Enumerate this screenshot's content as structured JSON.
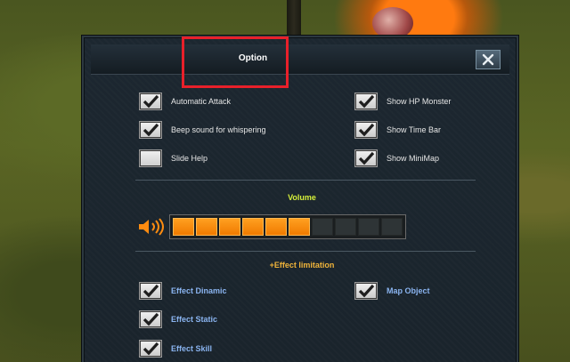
{
  "window": {
    "title": "Option",
    "close_glyph": "✕"
  },
  "options": {
    "automatic_attack": {
      "label": "Automatic Attack",
      "checked": true
    },
    "beep_whisper": {
      "label": "Beep sound for whispering",
      "checked": true
    },
    "slide_help": {
      "label": "Slide Help",
      "checked": false
    },
    "show_hp_monster": {
      "label": "Show HP Monster",
      "checked": true
    },
    "show_time_bar": {
      "label": "Show Time Bar",
      "checked": true
    },
    "show_minimap": {
      "label": "Show MiniMap",
      "checked": true
    }
  },
  "volume": {
    "title": "Volume",
    "level": 6,
    "max": 10,
    "icon": "speaker-icon"
  },
  "effects": {
    "title": "+Effect limitation",
    "effect_dinamic": {
      "label": "Effect Dinamic",
      "checked": true
    },
    "effect_static": {
      "label": "Effect Static",
      "checked": true
    },
    "effect_skill": {
      "label": "Effect Skill",
      "checked": true
    },
    "map_object": {
      "label": "Map Object",
      "checked": true
    }
  },
  "colors": {
    "volume_title": "#d6f03a",
    "effect_title": "#f0b43a",
    "effect_label": "#8ab4f0",
    "volume_fill": "#ff8c10",
    "highlight": "#e8202a"
  }
}
